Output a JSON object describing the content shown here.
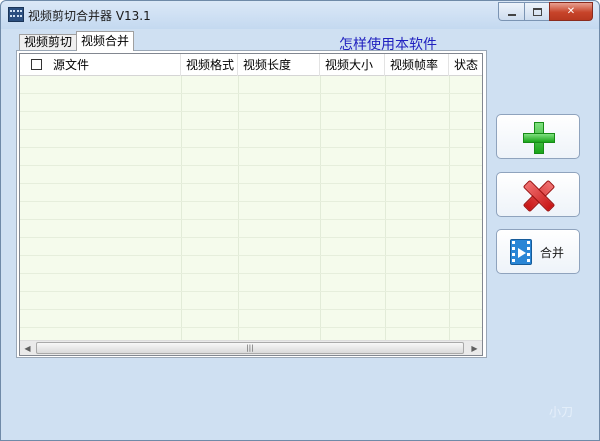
{
  "window": {
    "title": "视频剪切合并器 V13.1",
    "icon": "film-strip-icon",
    "controls": [
      "minimize",
      "maximize",
      "close"
    ]
  },
  "tabs": [
    {
      "label": "视频剪切",
      "selected": false
    },
    {
      "label": "视频合并",
      "selected": true
    }
  ],
  "help_link": "怎样使用本软件",
  "file_list": {
    "select_all_checked": false,
    "columns": [
      "源文件",
      "视频格式",
      "视频长度",
      "视频大小",
      "视频帧率",
      "状态"
    ],
    "rows": []
  },
  "scrollbar": {
    "thumb_grip": "|||"
  },
  "actions": {
    "add_icon": "green-plus-icon",
    "remove_icon": "red-x-icon",
    "merge_icon": "film-play-icon",
    "merge_label": "合并"
  },
  "watermark": "小刀",
  "colors": {
    "window_bg": "#cfe0f2",
    "list_bg": "#f5fbec",
    "link": "#1f1fbf",
    "add": "#1aa51a",
    "remove": "#c81414",
    "merge": "#2a86d6"
  }
}
